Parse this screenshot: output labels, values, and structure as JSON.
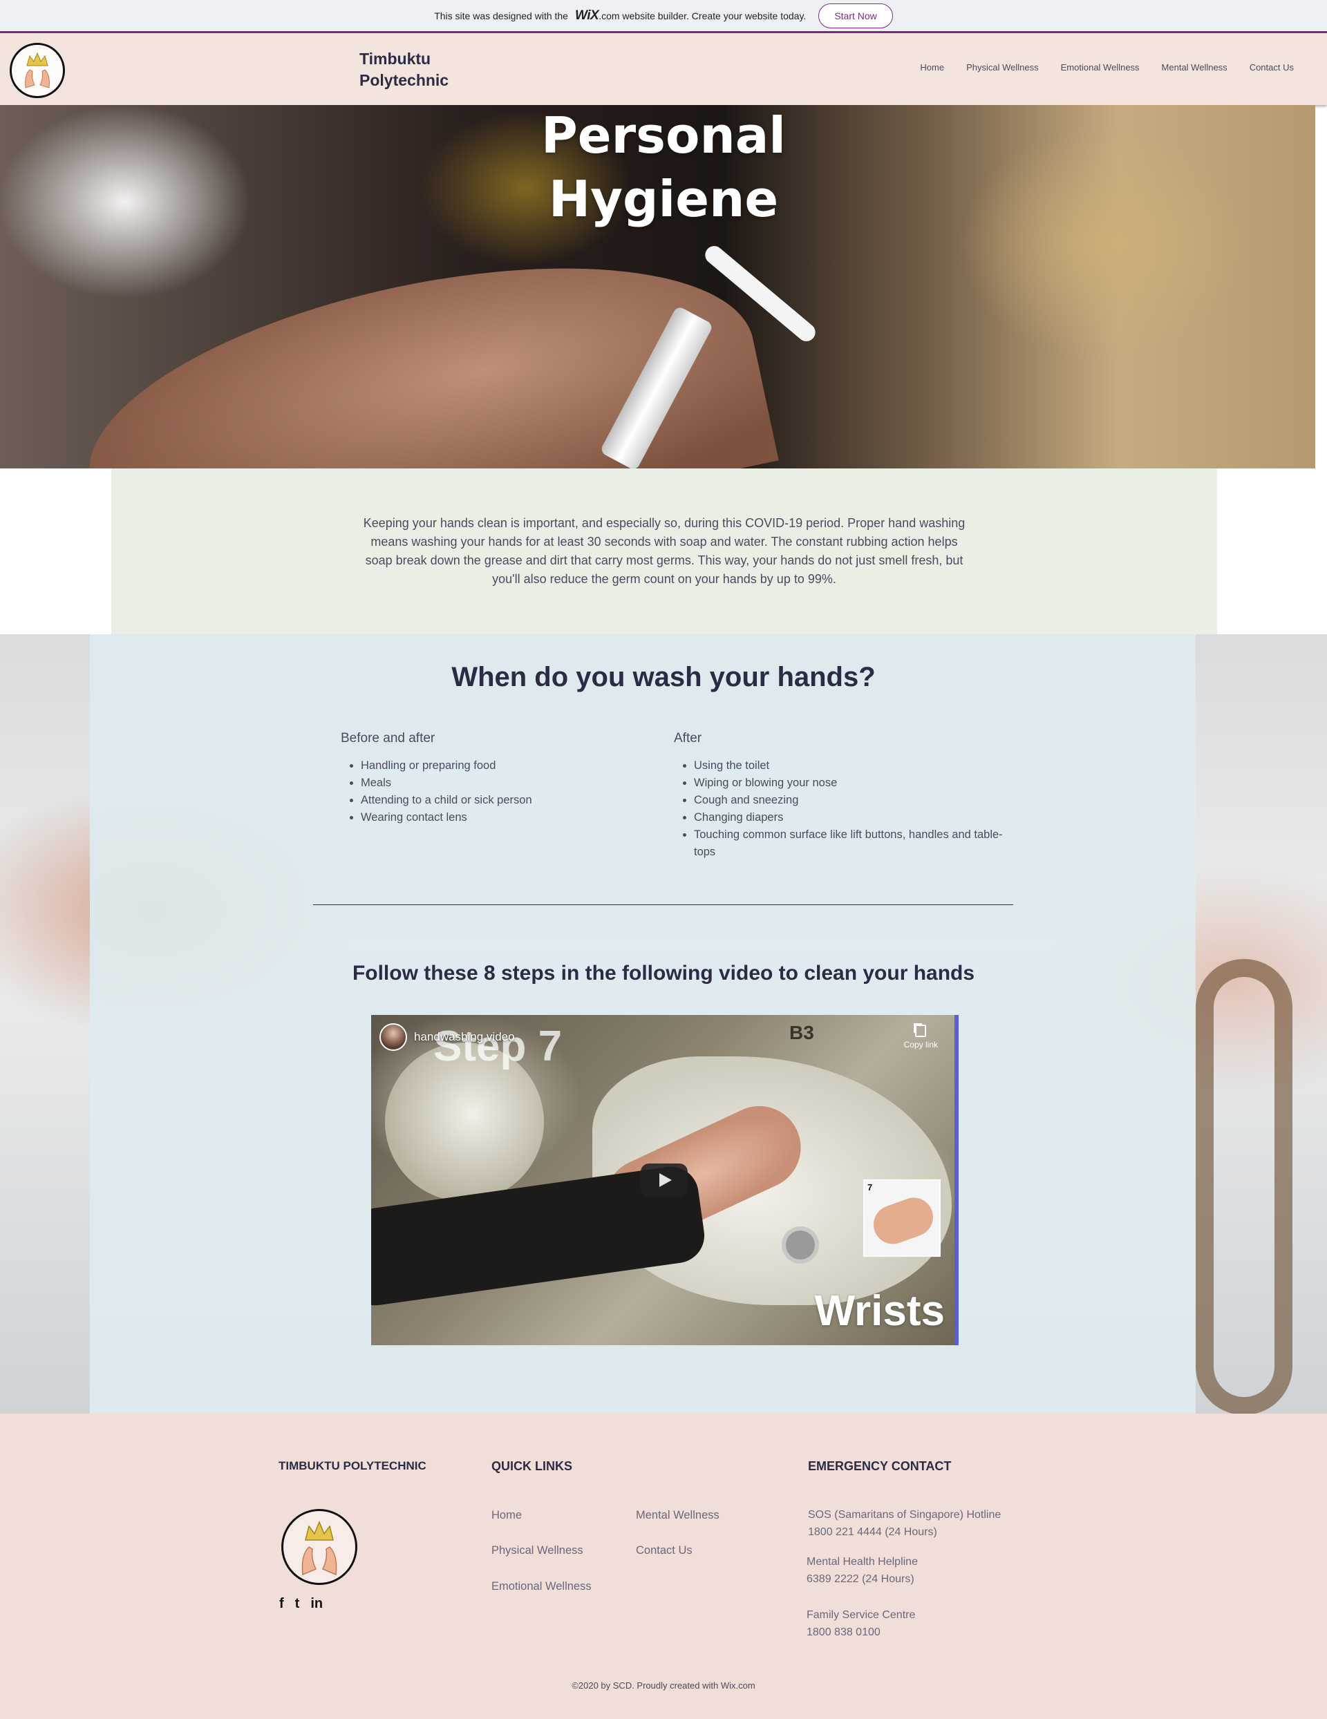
{
  "wix_banner": {
    "text_before": "This site was designed with the",
    "logo": "WiX",
    "text_after": ".com website builder. Create your website today.",
    "button": "Start Now"
  },
  "header": {
    "brand_line1": "Timbuktu",
    "brand_line2": "Polytechnic",
    "nav": [
      "Home",
      "Physical Wellness",
      "Emotional Wellness",
      "Mental Wellness",
      "Contact Us"
    ]
  },
  "hero": {
    "title_line1": "Personal",
    "title_line2": "Hygiene"
  },
  "intro": {
    "text": "Keeping your hands clean is important, and especially so, during this COVID-19 period. Proper hand washing means washing your hands for at least 30 seconds with soap and water. The constant rubbing action helps soap break down the grease and dirt that carry most germs. This way, your hands do not just smell fresh, but you'll also reduce the germ count on your hands by up to 99%."
  },
  "wash": {
    "title": "When do you wash your hands?",
    "left": {
      "heading": "Before and after",
      "items": [
        "Handling or preparing food",
        "Meals",
        "Attending to a child or sick person",
        "Wearing contact lens"
      ]
    },
    "right": {
      "heading": "After",
      "items": [
        "Using the toilet",
        "Wiping or blowing your nose",
        "Cough and sneezing",
        "Changing diapers",
        "Touching common surface like lift buttons, handles and table-tops"
      ]
    },
    "video_heading": "Follow  these 8 steps in the following video to clean your hands"
  },
  "video": {
    "title": "handwashing video",
    "copy_label": "Copy link",
    "overlay_step": "Step 7",
    "overlay_b3": "B3",
    "overlay_label": "Wrists",
    "thumb_number": "7"
  },
  "footer": {
    "brand": "TIMBUKTU POLYTECHNIC",
    "quick_links_heading": "QUICK LINKS",
    "links_col1": [
      "Home",
      "Physical Wellness",
      "Emotional Wellness"
    ],
    "links_col2": [
      "Mental Wellness",
      "Contact Us"
    ],
    "emergency_heading": "EMERGENCY CONTACT",
    "contacts": [
      {
        "name": "SOS (Samaritans of Singapore) Hotline",
        "number": "1800 221 4444 (24 Hours)"
      },
      {
        "name": "Mental Health Helpline",
        "number": "6389 2222 (24 Hours)"
      },
      {
        "name": "Family Service Centre",
        "number": "1800 838 0100"
      }
    ],
    "social": [
      "f",
      "t",
      "in"
    ],
    "copyright": "©2020 by SCD. Proudly created with Wix.com"
  },
  "colors": {
    "accent": "#7b2a86",
    "header_bg": "#f3e4de",
    "footer_bg": "#f1ded8",
    "intro_bg": "#eaefe6",
    "text_dark": "#2c2b45"
  },
  "icons": [
    "crown-hands-logo-icon",
    "facebook-icon",
    "twitter-icon",
    "linkedin-icon",
    "play-icon",
    "copy-link-icon"
  ]
}
